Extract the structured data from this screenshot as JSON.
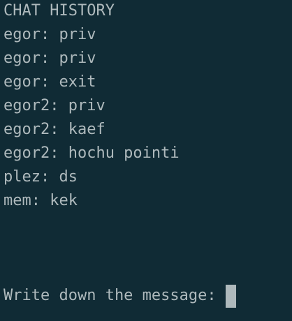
{
  "title": "CHAT HISTORY",
  "messages": [
    "egor: priv",
    "egor: priv",
    "egor: exit",
    "egor2: priv",
    "egor2: kaef",
    "egor2: hochu pointi",
    "plez: ds",
    "mem: kek"
  ],
  "prompt": "Write down the message: ",
  "colors": {
    "background": "#102b35",
    "text": "#aeb9bc",
    "cursor": "#aeb9bc"
  }
}
